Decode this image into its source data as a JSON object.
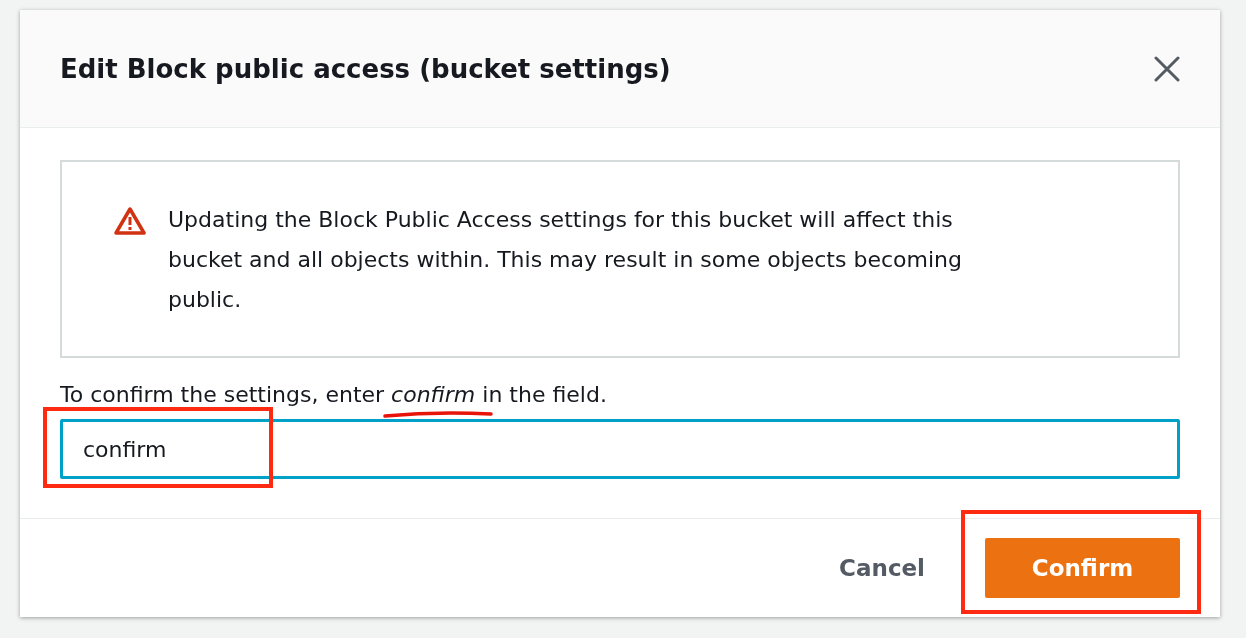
{
  "dialog": {
    "title": "Edit Block public access (bucket settings)",
    "alert": {
      "kind": "warning",
      "text": "Updating the Block Public Access settings for this bucket will affect this bucket and all objects within. This may result in some objects becoming public."
    },
    "confirm_label": {
      "text": "To confirm the settings, enter *confirm* in the field.",
      "underline_marked": true
    },
    "confirm_field": {
      "value": "confirm",
      "focused": true,
      "highlighted": true
    },
    "buttons": [
      {
        "label": "Cancel",
        "kind": "link",
        "highlighted": false
      },
      {
        "label": "Confirm",
        "kind": "primary",
        "highlighted": true
      }
    ]
  }
}
